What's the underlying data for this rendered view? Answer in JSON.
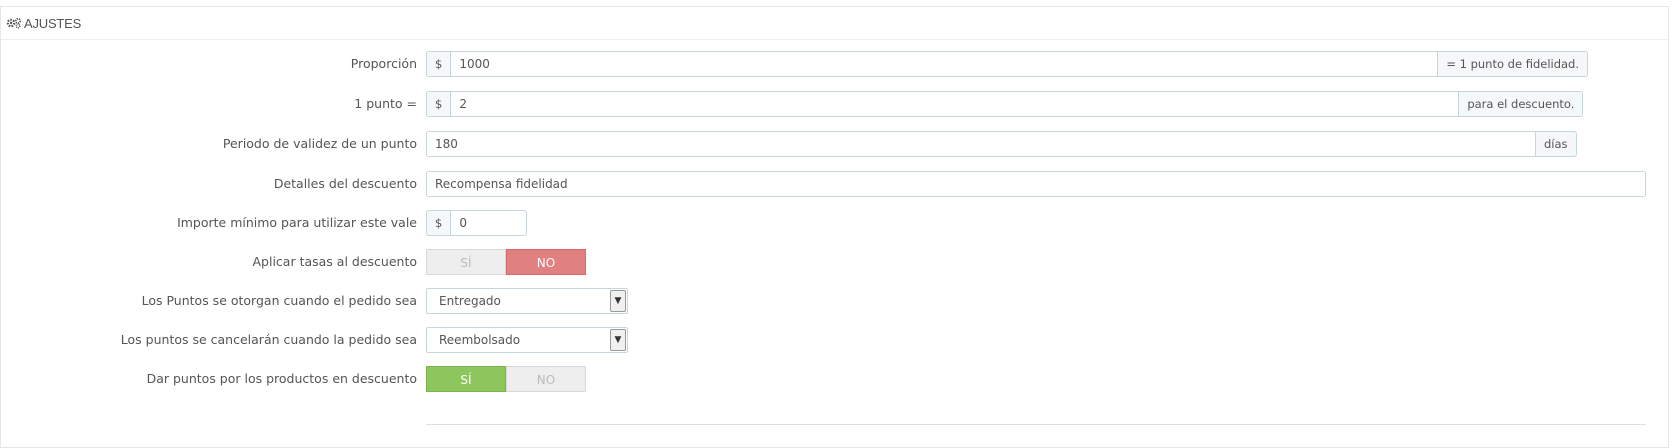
{
  "panel": {
    "title": "AJUSTES",
    "icon": "gears-icon"
  },
  "fields": {
    "ratio": {
      "label": "Proporción",
      "prefix": "$",
      "value": "1000",
      "suffix": "= 1 punto de fidelidad."
    },
    "point_value": {
      "label": "1 punto =",
      "prefix": "$",
      "value": "2",
      "suffix": "para el descuento."
    },
    "validity": {
      "label": "Periodo de validez de un punto",
      "value": "180",
      "suffix": "días"
    },
    "voucher_details": {
      "label": "Detalles del descuento",
      "value": "Recompensa fidelidad"
    },
    "min_amount": {
      "label": "Importe mínimo para utilizar este vale",
      "prefix": "$",
      "value": "0"
    },
    "apply_taxes": {
      "label": "Aplicar tasas al descuento",
      "yes": "SÍ",
      "no": "NO",
      "selected": "NO"
    },
    "points_awarded": {
      "label": "Los Puntos se otorgan cuando el pedido sea",
      "selected": "Entregado"
    },
    "points_cancelled": {
      "label": "Los puntos se cancelarán cuando la pedido sea",
      "selected": "Reembolsado"
    },
    "discounted_products": {
      "label": "Dar puntos por los productos en descuento",
      "yes": "SÍ",
      "no": "NO",
      "selected": "SÍ"
    }
  },
  "colors": {
    "active_yes": "#8cc65c",
    "active_no": "#e08080"
  }
}
